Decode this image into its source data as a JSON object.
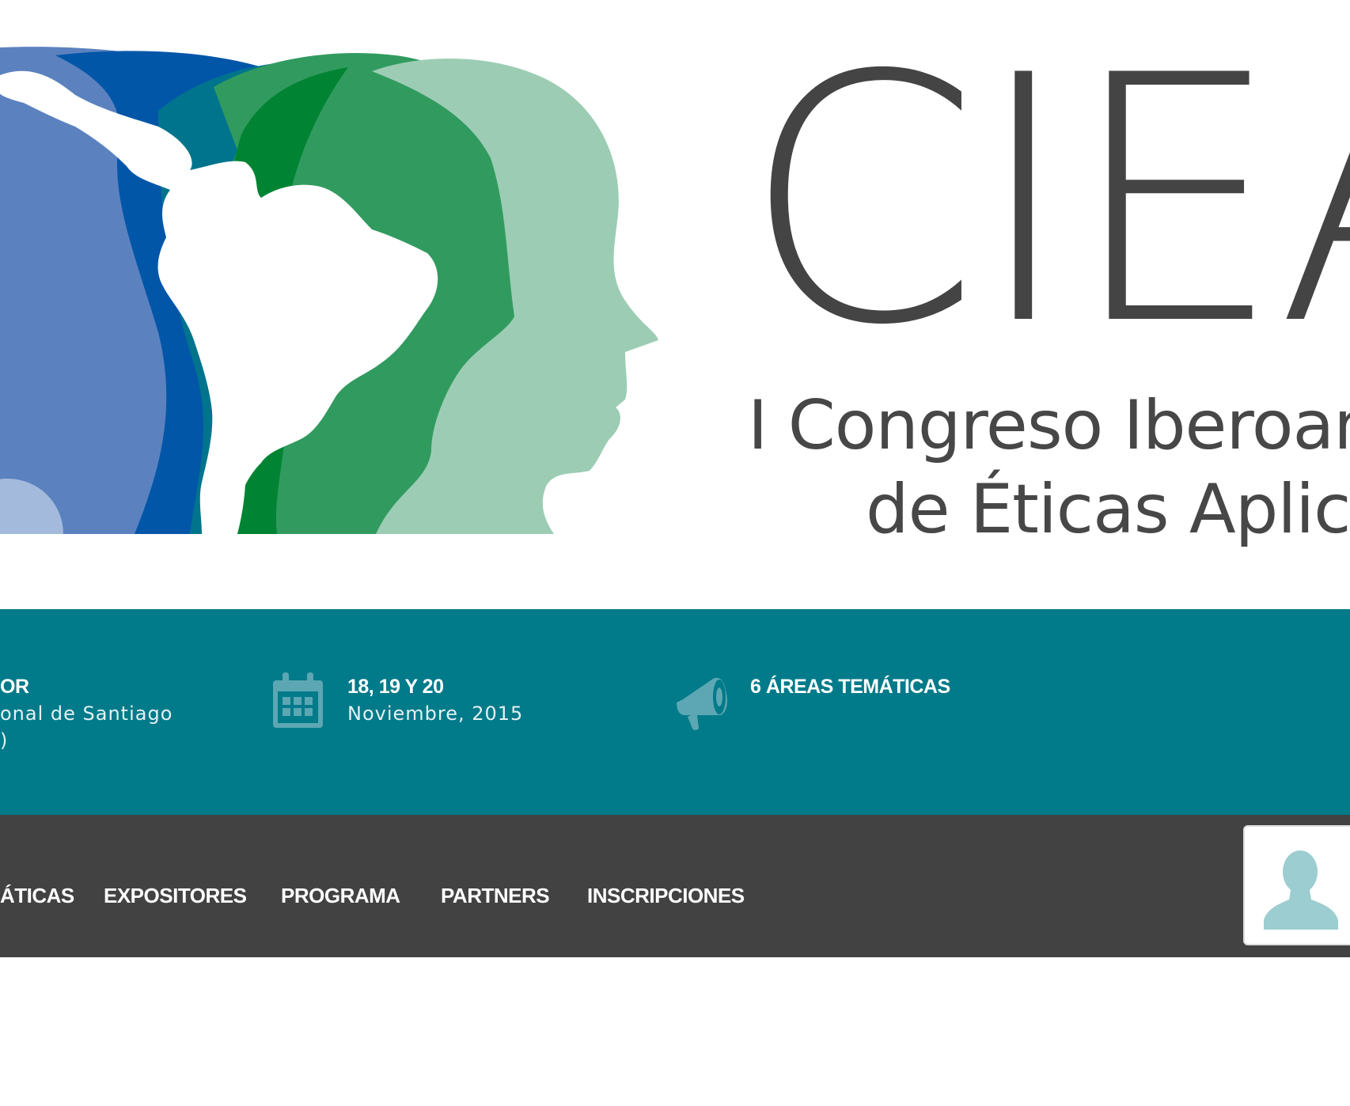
{
  "banner": {
    "logo_mark": "CIEA",
    "logo_line1": "I Congreso Iberoamericano",
    "logo_line2": "de Éticas Aplicadas"
  },
  "info": [
    {
      "icon": "location-icon",
      "title": "LUGAR DE REALIZACIÓN: UNIVERSIDAD MAYOR",
      "title_visible": "OR",
      "lines": [
        "onal de Santiago",
        ")"
      ]
    },
    {
      "icon": "calendar-icon",
      "title": "18, 19 Y 20",
      "lines": [
        "Noviembre, 2015"
      ]
    },
    {
      "icon": "megaphone-icon",
      "title": "6 ÁREAS TEMÁTICAS",
      "lines": []
    }
  ],
  "nav": {
    "items": [
      {
        "label": "ÁTICAS"
      },
      {
        "label": "EXPOSITORES"
      },
      {
        "label": "PROGRAMA"
      },
      {
        "label": "PARTNERS"
      },
      {
        "label": "INSCRIPCIONES"
      }
    ]
  },
  "avatar": {
    "icon": "user-avatar-icon"
  },
  "colors": {
    "teal_bar": "#017a89",
    "nav_bar": "#424242",
    "logo_text": "#444444",
    "avatar_icon": "#9ccdd1"
  }
}
